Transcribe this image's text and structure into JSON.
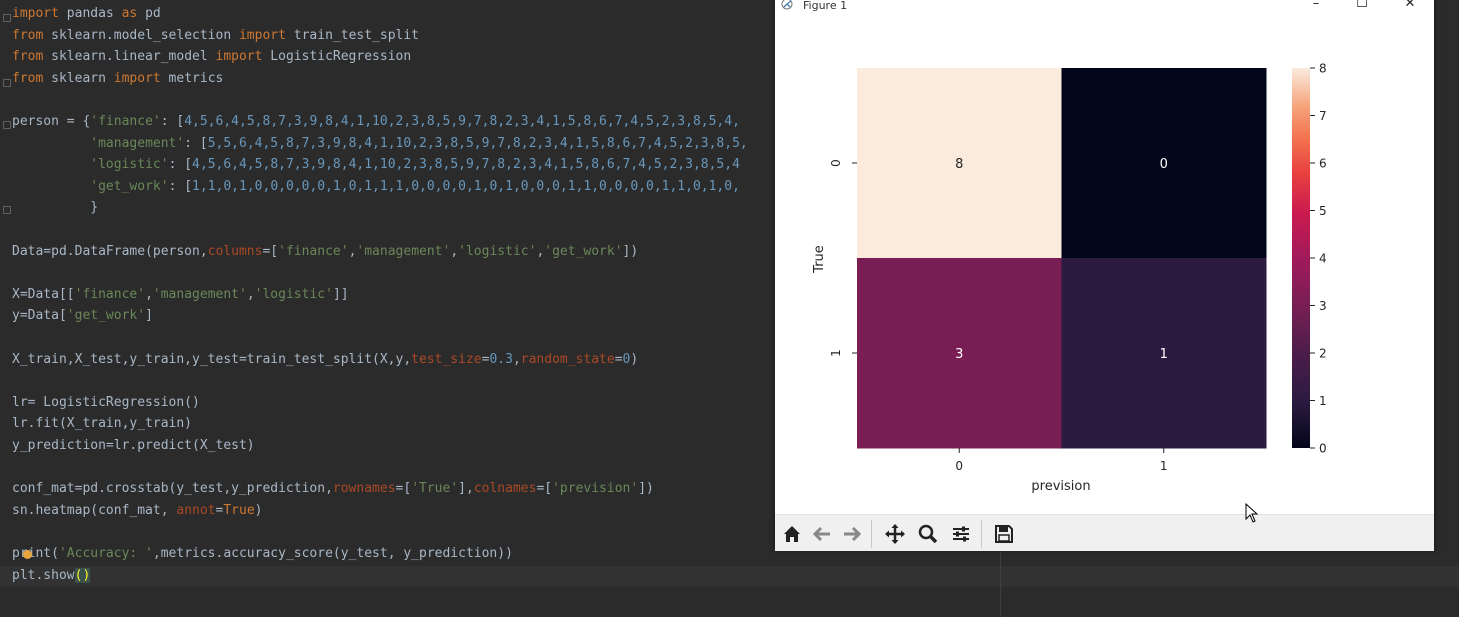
{
  "figure": {
    "title": "Figure 1",
    "controls": {
      "minimize": "–",
      "maximize": "☐",
      "close": "✕"
    },
    "toolbar": [
      "home-icon",
      "back-arrow-icon",
      "forward-arrow-icon",
      "pan-icon",
      "zoom-icon",
      "configure-subplots-icon",
      "save-icon"
    ]
  },
  "chart_data": {
    "type": "heatmap",
    "xlabel": "prevision",
    "ylabel": "True",
    "x_tick_labels": [
      "0",
      "1"
    ],
    "y_tick_labels": [
      "0",
      "1"
    ],
    "values": [
      [
        8,
        0
      ],
      [
        3,
        1
      ]
    ],
    "annotations": [
      "8",
      "0",
      "3",
      "1"
    ],
    "colorbar": {
      "ticks": [
        "0",
        "1",
        "2",
        "3",
        "4",
        "5",
        "6",
        "7",
        "8"
      ],
      "range": [
        0,
        8
      ]
    }
  },
  "code": [
    [
      [
        "kw",
        "import"
      ],
      [
        "p",
        " pandas "
      ],
      [
        "kw",
        "as"
      ],
      [
        "p",
        " pd"
      ]
    ],
    [
      [
        "kw",
        "from"
      ],
      [
        "p",
        " sklearn.model_selection "
      ],
      [
        "kw",
        "import"
      ],
      [
        "p",
        " train_test_split"
      ]
    ],
    [
      [
        "kw",
        "from"
      ],
      [
        "p",
        " sklearn.linear_model "
      ],
      [
        "kw",
        "import"
      ],
      [
        "p",
        " LogisticRegression"
      ]
    ],
    [
      [
        "kw",
        "from"
      ],
      [
        "p",
        " sklearn "
      ],
      [
        "kw",
        "import"
      ],
      [
        "p",
        " metrics"
      ]
    ],
    [],
    [
      [
        "p",
        "person = {"
      ],
      [
        "str",
        "'finance'"
      ],
      [
        "p",
        ": ["
      ],
      [
        "num",
        "4,5,6,4,5,8,7,3,9,8,4,1,10,2,3,8,5,9,7,8,2,3,4,1,5,8,6,7,4,5,2,3,8,5,4,"
      ]
    ],
    [
      [
        "p",
        "          "
      ],
      [
        "str",
        "'management'"
      ],
      [
        "p",
        ": ["
      ],
      [
        "num",
        "5,5,6,4,5,8,7,3,9,8,4,1,10,2,3,8,5,9,7,8,2,3,4,1,5,8,6,7,4,5,2,3,8,5,"
      ]
    ],
    [
      [
        "p",
        "          "
      ],
      [
        "str",
        "'logistic'"
      ],
      [
        "p",
        ": ["
      ],
      [
        "num",
        "4,5,6,4,5,8,7,3,9,8,4,1,10,2,3,8,5,9,7,8,2,3,4,1,5,8,6,7,4,5,2,3,8,5,4"
      ]
    ],
    [
      [
        "p",
        "          "
      ],
      [
        "str",
        "'get_work'"
      ],
      [
        "p",
        ": ["
      ],
      [
        "num",
        "1,1,0,1,0,0,0,0,0,1,0,1,1,1,0,0,0,0,1,0,1,0,0,0,1,1,0,0,0,0,1,1,0,1,0,"
      ]
    ],
    [
      [
        "p",
        "          }"
      ]
    ],
    [],
    [
      [
        "p",
        "Data=pd.DataFrame(person,"
      ],
      [
        "param",
        "columns"
      ],
      [
        "p",
        "=["
      ],
      [
        "str",
        "'finance'"
      ],
      [
        "p",
        ","
      ],
      [
        "str",
        "'management'"
      ],
      [
        "p",
        ","
      ],
      [
        "str",
        "'logistic'"
      ],
      [
        "p",
        ","
      ],
      [
        "str",
        "'get_work'"
      ],
      [
        "p",
        "])"
      ]
    ],
    [],
    [
      [
        "p",
        "X=Data[["
      ],
      [
        "str",
        "'finance'"
      ],
      [
        "p",
        ","
      ],
      [
        "str",
        "'management'"
      ],
      [
        "p",
        ","
      ],
      [
        "str",
        "'logistic'"
      ],
      [
        "p",
        "]]"
      ]
    ],
    [
      [
        "p",
        "y=Data["
      ],
      [
        "str",
        "'get_work'"
      ],
      [
        "p",
        "]"
      ]
    ],
    [],
    [
      [
        "p",
        "X_train,X_test,y_train,y_test=train_test_split(X,y,"
      ],
      [
        "param",
        "test_size"
      ],
      [
        "p",
        "="
      ],
      [
        "num",
        "0.3"
      ],
      [
        "p",
        ","
      ],
      [
        "param",
        "random_state"
      ],
      [
        "p",
        "="
      ],
      [
        "num",
        "0"
      ],
      [
        "p",
        ")"
      ]
    ],
    [],
    [
      [
        "p",
        "lr= LogisticRegression()"
      ]
    ],
    [
      [
        "p",
        "lr.fit(X_train,y_train)"
      ]
    ],
    [
      [
        "p",
        "y_prediction=lr.predict(X_test)"
      ]
    ],
    [],
    [
      [
        "p",
        "conf_mat=pd.crosstab(y_test,y_prediction,"
      ],
      [
        "param",
        "rownames"
      ],
      [
        "p",
        "=["
      ],
      [
        "str",
        "'True'"
      ],
      [
        "p",
        "],"
      ],
      [
        "param",
        "colnames"
      ],
      [
        "p",
        "=["
      ],
      [
        "str",
        "'prevision'"
      ],
      [
        "p",
        "])"
      ]
    ],
    [
      [
        "p",
        "sn.heatmap(conf_mat, "
      ],
      [
        "param",
        "annot"
      ],
      [
        "p",
        "="
      ],
      [
        "kw",
        "True"
      ],
      [
        "p",
        ")"
      ]
    ],
    [],
    [
      [
        "p",
        "print("
      ],
      [
        "str",
        "'Accuracy: '"
      ],
      [
        "p",
        ",metrics.accuracy_score(y_test, y_prediction))"
      ]
    ],
    [
      [
        "p",
        "plt.show"
      ],
      [
        "hl",
        "()"
      ]
    ]
  ]
}
